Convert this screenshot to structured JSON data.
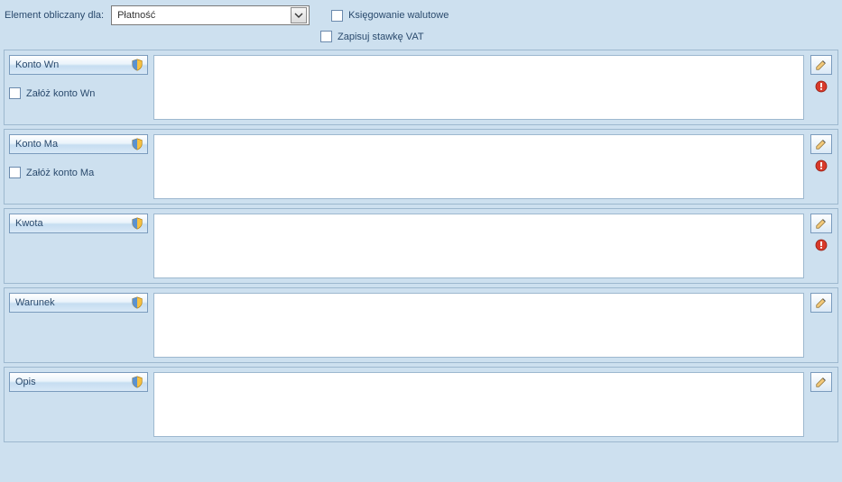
{
  "top": {
    "label": "Element obliczany dla:",
    "select_value": "Płatność",
    "checkbox1": "Księgowanie walutowe",
    "checkbox2": "Zapisuj stawkę VAT"
  },
  "sections": {
    "konto_wn": {
      "label": "Konto Wn",
      "checkbox": "Załóż konto Wn",
      "value": "",
      "has_error": true
    },
    "konto_ma": {
      "label": "Konto Ma",
      "checkbox": "Załóż konto Ma",
      "value": "",
      "has_error": true
    },
    "kwota": {
      "label": "Kwota",
      "value": "",
      "has_error": true
    },
    "warunek": {
      "label": "Warunek",
      "value": "",
      "has_error": false
    },
    "opis": {
      "label": "Opis",
      "value": "",
      "has_error": false
    }
  }
}
